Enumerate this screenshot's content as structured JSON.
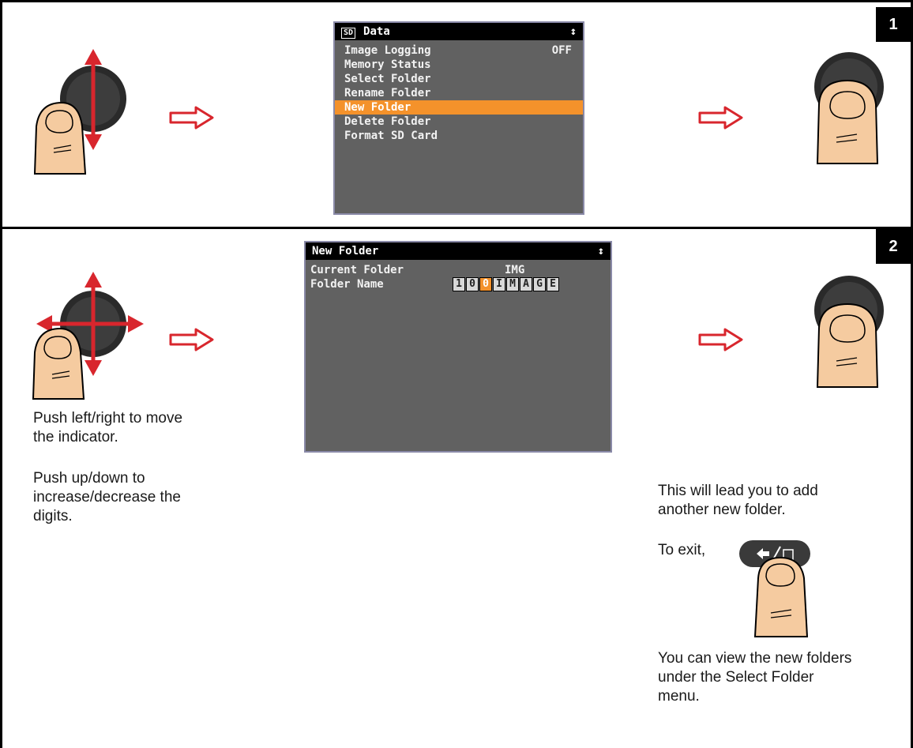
{
  "step1": {
    "badge": "1",
    "screen": {
      "header_icon": "SD",
      "title": "Data",
      "scroll_glyph": "↕",
      "items": [
        {
          "label": "Image Logging",
          "value": "OFF"
        },
        {
          "label": "Memory Status",
          "value": ""
        },
        {
          "label": "Select Folder",
          "value": ""
        },
        {
          "label": "Rename Folder",
          "value": ""
        },
        {
          "label": "New Folder",
          "value": "",
          "selected": true
        },
        {
          "label": "Delete Folder",
          "value": ""
        },
        {
          "label": "Format SD Card",
          "value": ""
        }
      ]
    }
  },
  "step2": {
    "badge": "2",
    "screen": {
      "title": "New Folder",
      "scroll_glyph": "↕",
      "current_folder_label": "Current Folder",
      "current_folder_value": "IMG",
      "folder_name_label": "Folder Name",
      "folder_name_chars": [
        "1",
        "0",
        "0",
        "I",
        "M",
        "A",
        "G",
        "E"
      ],
      "active_char_index": 2
    },
    "left_text_1": "Push left/right to move the indicator.",
    "left_text_2": "Push up/down to increase/decrease the digits.",
    "right_text_1": "This will lead you to add another new folder.",
    "right_text_2": "To exit,",
    "right_text_3": "You can view the new folders under the Select Folder menu."
  },
  "icons": {
    "arrow": "hollow-right-arrow-icon",
    "joystick": "joystick-icon",
    "thumb": "thumb-icon",
    "back_key": "back-exit-key-icon"
  },
  "colors": {
    "accent": "#f4922b",
    "screen_bg": "#616161",
    "arrow_red": "#d8262d",
    "skin": "#f5cba0"
  }
}
